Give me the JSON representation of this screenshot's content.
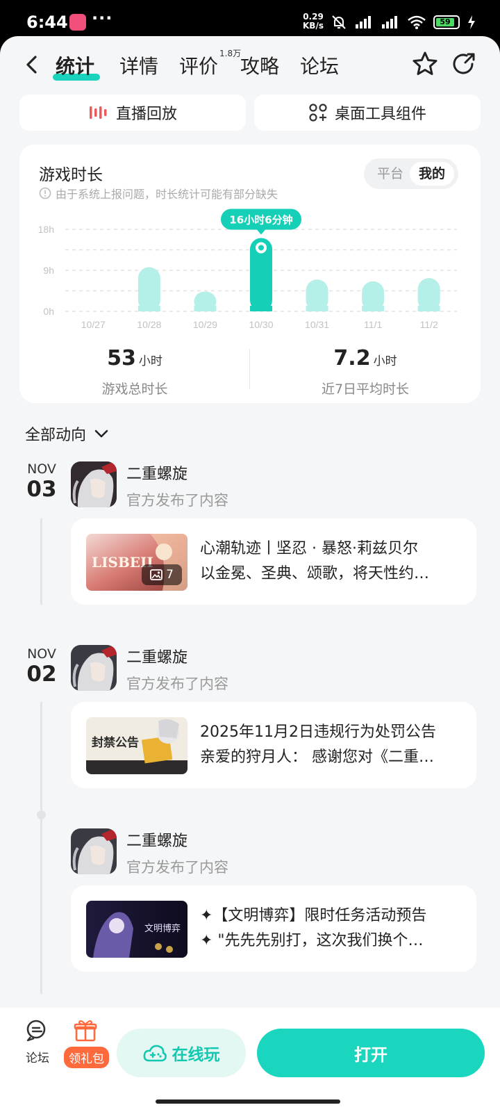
{
  "status_bar": {
    "time": "6:44",
    "dots": "···",
    "net_speed_value": "0.29",
    "net_speed_unit": "KB/s",
    "battery": "59"
  },
  "nav": {
    "tabs": [
      {
        "label": "统计",
        "active": true
      },
      {
        "label": "详情",
        "active": false
      },
      {
        "label": "评价",
        "active": false
      },
      {
        "label": "攻略",
        "active": false
      },
      {
        "label": "论坛",
        "active": false
      }
    ],
    "review_count_badge": "1.8万"
  },
  "quick_actions": {
    "replay_label": "直播回放",
    "widget_label": "桌面工具组件"
  },
  "stats": {
    "title": "游戏时长",
    "note": "由于系统上报问题，时长统计可能有部分缺失",
    "toggle": {
      "platform": "平台",
      "mine": "我的",
      "selected": "我的"
    },
    "total_value": "53",
    "total_unit": "小时",
    "total_label": "游戏总时长",
    "avg_value": "7.2",
    "avg_unit": "小时",
    "avg_label": "近7日平均时长"
  },
  "chart_data": {
    "type": "bar",
    "categories": [
      "10/27",
      "10/28",
      "10/29",
      "10/30",
      "10/31",
      "11/1",
      "11/2"
    ],
    "values": [
      0,
      9.7,
      4.3,
      16.1,
      7.0,
      6.6,
      7.3
    ],
    "ylim": [
      0,
      18
    ],
    "yticks": [
      {
        "v": 0,
        "label": "0h"
      },
      {
        "v": 9,
        "label": "9h"
      },
      {
        "v": 18,
        "label": "18h"
      }
    ],
    "highlight_index": 3,
    "tooltip": "16小时6分钟",
    "grid": true,
    "colors": {
      "bar": "#b5f0e8",
      "highlight": "#15cfb6",
      "grid": "#e2e2e2",
      "tick": "#c2c2c2"
    }
  },
  "feed": {
    "filter_label": "全部动向",
    "groups": [
      {
        "month": "NOV",
        "day": "03",
        "poster": "二重螺旋",
        "action": "官方发布了内容",
        "line1": "心潮轨迹丨坚忍 · 暴怒·莉兹贝尔",
        "line2": "以金冕、圣典、颂歌，将天性约…",
        "image_count": "7",
        "thumb_text": "LISBEII"
      },
      {
        "month": "NOV",
        "day": "02",
        "poster": "二重螺旋",
        "action": "官方发布了内容",
        "line1": "2025年11月2日违规行为处罚公告",
        "line2": "亲爱的狩月人： 感谢您对《二重…",
        "thumb_text": "封禁公告"
      },
      {
        "poster": "二重螺旋",
        "action": "官方发布了内容",
        "line1": "✦【文明博弈】限时任务活动预告",
        "line2": "✦ \"先先先别打，这次我们换个…",
        "thumb_text": "文明博弈"
      }
    ]
  },
  "bottom_bar": {
    "forum_label": "论坛",
    "gift_label": "领礼包",
    "online_label": "在线玩",
    "open_label": "打开"
  }
}
